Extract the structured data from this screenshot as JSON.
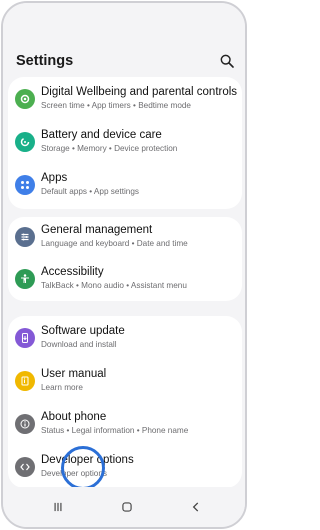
{
  "header": {
    "title": "Settings"
  },
  "cards": [
    {
      "items": [
        {
          "id": "digital-wellbeing",
          "label": "Digital Wellbeing and parental controls",
          "sub": "Screen time  •  App timers  •  Bedtime mode",
          "color": "#4caf50"
        },
        {
          "id": "battery",
          "label": "Battery and device care",
          "sub": "Storage  •  Memory  •  Device protection",
          "color": "#19b089"
        },
        {
          "id": "apps",
          "label": "Apps",
          "sub": "Default apps  •  App settings",
          "color": "#3f7fe8"
        }
      ]
    },
    {
      "items": [
        {
          "id": "general-management",
          "label": "General management",
          "sub": "Language and keyboard  •  Date and time",
          "color": "#5a6f8f"
        },
        {
          "id": "accessibility",
          "label": "Accessibility",
          "sub": "TalkBack  •  Mono audio  •  Assistant menu",
          "color": "#2e9b55"
        }
      ]
    },
    {
      "items": [
        {
          "id": "software-update",
          "label": "Software update",
          "sub": "Download and install",
          "color": "#8459d6"
        },
        {
          "id": "user-manual",
          "label": "User manual",
          "sub": "Learn more",
          "color": "#f0b800"
        },
        {
          "id": "about-phone",
          "label": "About phone",
          "sub": "Status  •  Legal information  •  Phone name",
          "color": "#6f6f73"
        },
        {
          "id": "developer-options",
          "label": "Developer options",
          "sub": "Developer options",
          "color": "#6f6f73"
        }
      ]
    }
  ],
  "icons": {
    "search": "search-icon",
    "recent": "recent-apps-icon",
    "home": "home-icon",
    "back": "back-icon"
  }
}
